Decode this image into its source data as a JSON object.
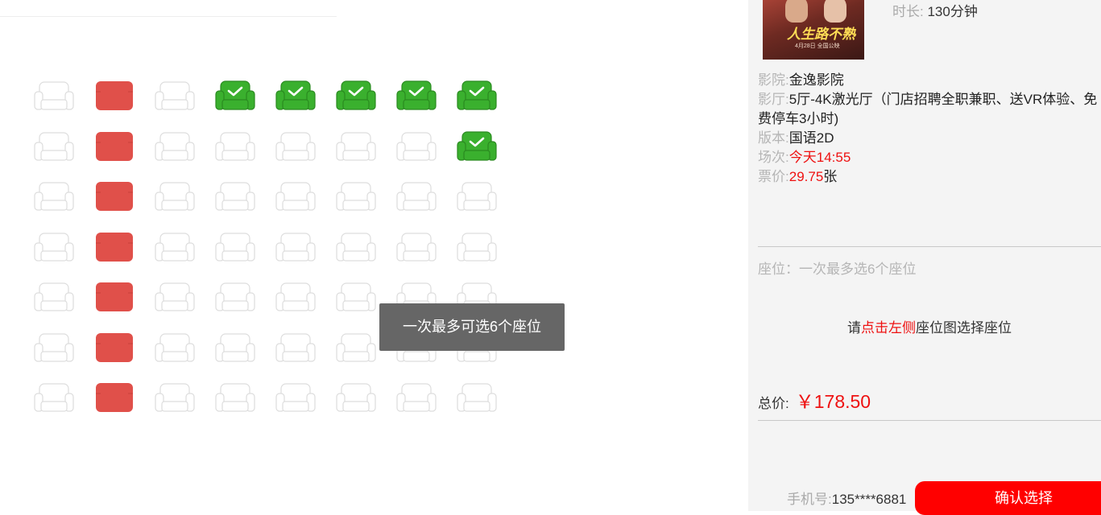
{
  "seat_map": {
    "legend_colors": {
      "available": "#dddddd",
      "sold": "#e0504a",
      "selected": "#3ab02e"
    },
    "rows": [
      [
        "available",
        "sold",
        "available",
        "selected",
        "selected",
        "selected",
        "selected",
        "selected"
      ],
      [
        "available",
        "sold",
        "available",
        "available",
        "available",
        "available",
        "available",
        "selected"
      ],
      [
        "available",
        "sold",
        "available",
        "available",
        "available",
        "available",
        "available",
        "available"
      ],
      [
        "available",
        "sold",
        "available",
        "available",
        "available",
        "available",
        "available",
        "available"
      ],
      [
        "available",
        "sold",
        "available",
        "available",
        "available",
        "available",
        "available",
        "available"
      ],
      [
        "available",
        "sold",
        "available",
        "available",
        "available",
        "available",
        "available",
        "available"
      ],
      [
        "available",
        "sold",
        "available",
        "available",
        "available",
        "available",
        "available",
        "available"
      ]
    ]
  },
  "toast": {
    "message": "一次最多可选6个座位"
  },
  "movie": {
    "duration_label": "时长:",
    "duration_value": "130分钟",
    "cinema_label": "影院:",
    "cinema_value": "金逸影院",
    "hall_label": "影厅:",
    "hall_value": "5厅-4K激光厅（门店招聘全职兼职、送VR体验、免费停车3小时)",
    "version_label": "版本:",
    "version_value": "国语2D",
    "showtime_label": "场次:",
    "showtime_value": "今天14:55",
    "price_label": "票价:",
    "price_value": "29.75",
    "price_unit": "张"
  },
  "seats_summary": {
    "label": "座位：一次最多选6个座位",
    "hint_prefix": "请",
    "hint_highlight": "点击左侧",
    "hint_suffix": "座位图选择座位"
  },
  "total": {
    "label": "总价:",
    "amount": "￥178.50"
  },
  "phone": {
    "label": "手机号:",
    "value": "135****6881"
  },
  "confirm_button": {
    "label": "确认选择"
  }
}
